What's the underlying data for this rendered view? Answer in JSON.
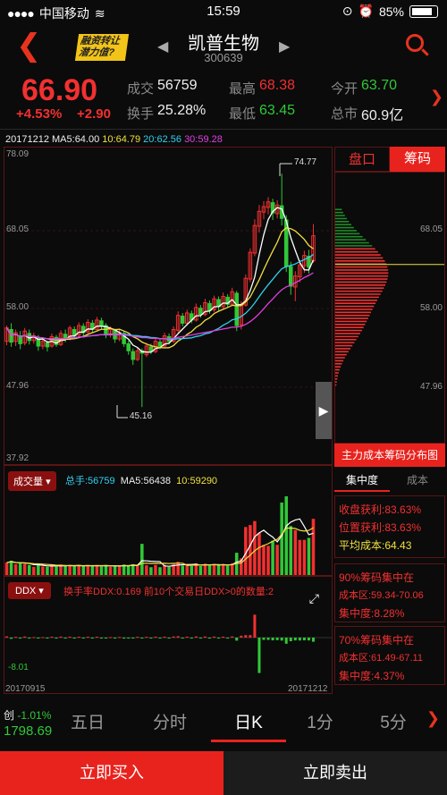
{
  "status_bar": {
    "carrier": "中国移动",
    "time": "15:59",
    "battery": "85%"
  },
  "header": {
    "stock_name": "凯普生物",
    "stock_code": "300639",
    "logo_text": "融资转让 潜力值?"
  },
  "quote": {
    "price": "66.90",
    "change_pct": "+4.53%",
    "change_abs": "+2.90",
    "volume_label": "成交",
    "volume": "56759",
    "high_label": "最高",
    "high": "68.38",
    "open_label": "今开",
    "open": "63.70",
    "turnover_label": "换手",
    "turnover": "25.28%",
    "low_label": "最低",
    "low": "63.45",
    "mktcap_label": "总市",
    "mktcap": "60.9亿"
  },
  "ma_legend": {
    "date": "20171212",
    "ma5": "MA5:64.00",
    "ma10": "10:64.79",
    "ma20": "20:62.56",
    "ma30": "30:59.28"
  },
  "kline": {
    "y_top": "78.09",
    "y_68": "68.05",
    "y_58": "58.00",
    "y_48": "47.96",
    "y_bottom": "37.92",
    "max_label": "74.77",
    "min_label": "45.16"
  },
  "volume_panel": {
    "selector": "成交量",
    "total": "总手:56759",
    "ma5": "MA5:56438",
    "ma10": "10:59290"
  },
  "ddx_panel": {
    "selector": "DDX",
    "info": "换手率DDX:0.169   前10个交易日DDX>0的数量:2",
    "min_label": "-8.01",
    "start_date": "20170915",
    "end_date": "20171212"
  },
  "side_panel": {
    "tab_pankou": "盘口",
    "tab_chouma": "筹码",
    "y_68": "68.05",
    "y_58": "58.00",
    "y_48": "47.96",
    "title": "主力成本筹码分布图",
    "subtab_concentration": "集中度",
    "subtab_cost": "成本",
    "profit_close": "收盘获利:83.63%",
    "profit_position": "位置获利:83.63%",
    "avg_cost": "平均成本:64.43",
    "c90_title": "90%筹码集中在",
    "c90_range": "成本区:59.34-70.06",
    "c90_conc": "集中度:8.28%",
    "c70_title": "70%筹码集中在",
    "c70_range": "成本区:61.49-67.11",
    "c70_conc": "集中度:4.37%"
  },
  "index_ticker": {
    "name": "创",
    "change": "-1.01%",
    "value": "1798.69"
  },
  "periods": [
    "五日",
    "分时",
    "日K",
    "1分",
    "5分"
  ],
  "actions": {
    "buy": "立即买入",
    "sell": "立即卖出"
  },
  "colors": {
    "up": "#f23030",
    "down": "#30c838",
    "accent": "#e8231e"
  },
  "chart_data": {
    "type": "candlestick",
    "candles": [
      [
        53.5,
        55.2,
        53.0,
        55.5
      ],
      [
        55.0,
        53.4,
        52.8,
        55.8
      ],
      [
        53.5,
        54.6,
        52.9,
        55.0
      ],
      [
        54.2,
        53.2,
        52.5,
        54.8
      ],
      [
        53.3,
        54.8,
        53.0,
        55.2
      ],
      [
        54.5,
        53.6,
        53.1,
        55.0
      ],
      [
        53.6,
        54.2,
        53.2,
        54.6
      ],
      [
        54.0,
        52.9,
        52.3,
        54.3
      ],
      [
        52.9,
        53.5,
        52.5,
        54.0
      ],
      [
        53.3,
        52.8,
        52.2,
        53.6
      ],
      [
        52.9,
        54.1,
        52.7,
        54.5
      ],
      [
        54.0,
        53.1,
        52.8,
        54.3
      ],
      [
        53.1,
        54.5,
        52.9,
        54.9
      ],
      [
        54.4,
        53.9,
        53.4,
        55.0
      ],
      [
        53.9,
        55.2,
        53.6,
        55.5
      ],
      [
        55.0,
        54.2,
        53.8,
        55.4
      ],
      [
        54.3,
        55.5,
        54.1,
        55.9
      ],
      [
        55.4,
        54.6,
        54.2,
        55.8
      ],
      [
        54.7,
        55.9,
        54.5,
        56.3
      ],
      [
        55.8,
        55.0,
        54.6,
        56.2
      ],
      [
        55.0,
        56.2,
        54.8,
        56.6
      ],
      [
        56.1,
        55.4,
        55.0,
        56.5
      ],
      [
        55.5,
        54.3,
        53.9,
        55.8
      ],
      [
        54.3,
        55.0,
        54.0,
        55.4
      ],
      [
        54.9,
        53.8,
        53.3,
        55.1
      ],
      [
        53.8,
        54.6,
        53.5,
        55.0
      ],
      [
        54.5,
        53.2,
        52.8,
        54.8
      ],
      [
        53.2,
        52.3,
        51.8,
        53.6
      ],
      [
        52.2,
        51.2,
        50.5,
        52.6
      ],
      [
        51.2,
        52.3,
        51.0,
        52.7
      ],
      [
        52.3,
        52.0,
        45.16,
        52.6
      ],
      [
        51.8,
        52.9,
        51.5,
        53.3
      ],
      [
        52.8,
        52.2,
        51.9,
        53.2
      ],
      [
        52.2,
        53.5,
        52.0,
        53.9
      ],
      [
        53.4,
        52.9,
        52.5,
        53.8
      ],
      [
        52.9,
        54.2,
        52.7,
        54.6
      ],
      [
        54.1,
        53.5,
        53.1,
        54.5
      ],
      [
        53.5,
        55.0,
        53.3,
        55.4
      ],
      [
        54.9,
        56.8,
        54.6,
        57.3
      ],
      [
        56.7,
        55.8,
        55.4,
        57.1
      ],
      [
        55.8,
        57.1,
        55.5,
        57.5
      ],
      [
        57.0,
        56.2,
        55.8,
        57.4
      ],
      [
        56.2,
        57.8,
        56.0,
        58.3
      ],
      [
        57.7,
        56.9,
        56.5,
        58.1
      ],
      [
        56.9,
        58.4,
        56.7,
        58.9
      ],
      [
        58.3,
        57.4,
        57.0,
        58.7
      ],
      [
        57.5,
        58.9,
        57.2,
        59.3
      ],
      [
        58.8,
        57.9,
        57.4,
        59.2
      ],
      [
        57.9,
        59.2,
        57.6,
        59.7
      ],
      [
        59.1,
        58.2,
        57.8,
        59.5
      ],
      [
        58.2,
        59.8,
        58.0,
        60.3
      ],
      [
        59.6,
        55.5,
        54.8,
        59.9
      ],
      [
        55.6,
        58.2,
        55.0,
        58.6
      ],
      [
        58.1,
        61.5,
        57.9,
        62.0
      ],
      [
        61.4,
        64.8,
        61.0,
        65.3
      ],
      [
        64.7,
        68.2,
        64.3,
        69.0
      ],
      [
        68.1,
        70.0,
        67.3,
        70.8
      ],
      [
        69.9,
        70.6,
        69.0,
        71.3
      ],
      [
        70.5,
        71.2,
        69.6,
        71.8
      ],
      [
        71.1,
        69.8,
        68.9,
        71.6
      ],
      [
        69.7,
        70.8,
        69.1,
        71.4
      ],
      [
        70.7,
        69.1,
        68.2,
        74.77
      ],
      [
        68.9,
        63.0,
        62.3,
        69.5
      ],
      [
        63.0,
        60.5,
        59.4,
        63.6
      ],
      [
        60.4,
        61.8,
        58.6,
        62.4
      ],
      [
        61.7,
        63.2,
        61.0,
        63.8
      ],
      [
        63.1,
        64.4,
        62.2,
        65.0
      ],
      [
        64.3,
        62.9,
        62.1,
        65.1
      ],
      [
        63.7,
        66.9,
        63.45,
        68.38
      ]
    ],
    "volume_total": 56759,
    "volume_ma5": 56438,
    "volume_ma10": 59290,
    "ma5": 64.0,
    "ma10": 64.79,
    "ma20": 62.56,
    "ma30": 59.28,
    "y_range": [
      37.92,
      78.09
    ],
    "x_start": "20170915",
    "x_end": "20171212"
  }
}
